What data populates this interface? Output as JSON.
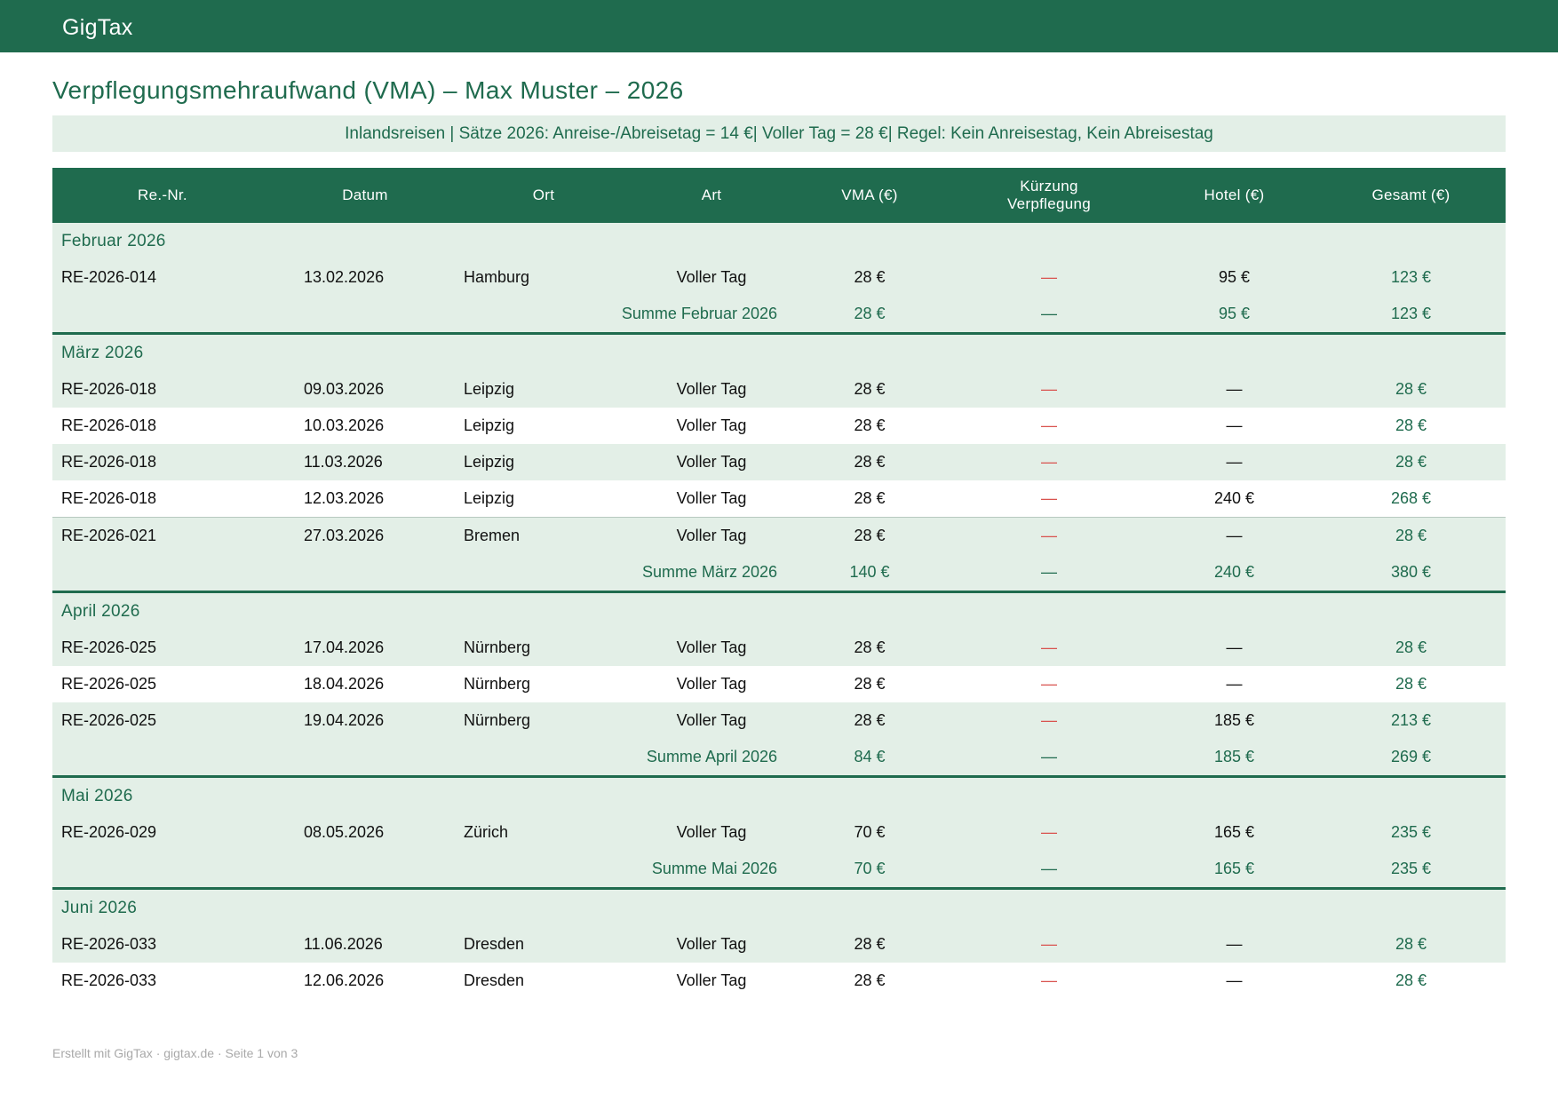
{
  "app": {
    "name": "GigTax"
  },
  "document": {
    "title": "Verpflegungsmehraufwand (VMA) – Max Muster – 2026",
    "info": "Inlandsreisen | Sätze 2026: Anreise-/Abreisetag = 14 €| Voller Tag = 28 €| Regel: Kein Anreisestag, Kein Abreisestag",
    "footer": "Erstellt mit GigTax · gigtax.de · Seite 1 von 3"
  },
  "table": {
    "headers": {
      "re": "Re.-Nr.",
      "datum": "Datum",
      "ort": "Ort",
      "art": "Art",
      "vma": "VMA (€)",
      "kuerzung_1": "Kürzung",
      "kuerzung_2": "Verpflegung",
      "hotel": "Hotel (€)",
      "gesamt": "Gesamt (€)"
    },
    "groups": [
      {
        "month": "Februar 2026",
        "rows": [
          {
            "re": "RE-2026-014",
            "datum": "13.02.2026",
            "ort": "Hamburg",
            "art": "Voller Tag",
            "vma": "28 €",
            "kuerzung": "—",
            "hotel": "95 €",
            "gesamt": "123 €"
          }
        ],
        "sum": {
          "label": "Summe Februar 2026",
          "vma": "28 €",
          "kuerzung": "—",
          "hotel": "95 €",
          "gesamt": "123 €"
        }
      },
      {
        "month": "März 2026",
        "rows": [
          {
            "re": "RE-2026-018",
            "datum": "09.03.2026",
            "ort": "Leipzig",
            "art": "Voller Tag",
            "vma": "28 €",
            "kuerzung": "—",
            "hotel": "—",
            "gesamt": "28 €"
          },
          {
            "re": "RE-2026-018",
            "datum": "10.03.2026",
            "ort": "Leipzig",
            "art": "Voller Tag",
            "vma": "28 €",
            "kuerzung": "—",
            "hotel": "—",
            "gesamt": "28 €"
          },
          {
            "re": "RE-2026-018",
            "datum": "11.03.2026",
            "ort": "Leipzig",
            "art": "Voller Tag",
            "vma": "28 €",
            "kuerzung": "—",
            "hotel": "—",
            "gesamt": "28 €"
          },
          {
            "re": "RE-2026-018",
            "datum": "12.03.2026",
            "ort": "Leipzig",
            "art": "Voller Tag",
            "vma": "28 €",
            "kuerzung": "—",
            "hotel": "240 €",
            "gesamt": "268 €"
          },
          {
            "re": "RE-2026-021",
            "datum": "27.03.2026",
            "ort": "Bremen",
            "art": "Voller Tag",
            "vma": "28 €",
            "kuerzung": "—",
            "hotel": "—",
            "gesamt": "28 €"
          }
        ],
        "sum": {
          "label": "Summe März 2026",
          "vma": "140 €",
          "kuerzung": "—",
          "hotel": "240 €",
          "gesamt": "380 €"
        }
      },
      {
        "month": "April 2026",
        "rows": [
          {
            "re": "RE-2026-025",
            "datum": "17.04.2026",
            "ort": "Nürnberg",
            "art": "Voller Tag",
            "vma": "28 €",
            "kuerzung": "—",
            "hotel": "—",
            "gesamt": "28 €"
          },
          {
            "re": "RE-2026-025",
            "datum": "18.04.2026",
            "ort": "Nürnberg",
            "art": "Voller Tag",
            "vma": "28 €",
            "kuerzung": "—",
            "hotel": "—",
            "gesamt": "28 €"
          },
          {
            "re": "RE-2026-025",
            "datum": "19.04.2026",
            "ort": "Nürnberg",
            "art": "Voller Tag",
            "vma": "28 €",
            "kuerzung": "—",
            "hotel": "185 €",
            "gesamt": "213 €"
          }
        ],
        "sum": {
          "label": "Summe April 2026",
          "vma": "84 €",
          "kuerzung": "—",
          "hotel": "185 €",
          "gesamt": "269 €"
        }
      },
      {
        "month": "Mai 2026",
        "rows": [
          {
            "re": "RE-2026-029",
            "datum": "08.05.2026",
            "ort": "Zürich",
            "art": "Voller Tag",
            "vma": "70 €",
            "kuerzung": "—",
            "hotel": "165 €",
            "gesamt": "235 €"
          }
        ],
        "sum": {
          "label": "Summe Mai 2026",
          "vma": "70 €",
          "kuerzung": "—",
          "hotel": "165 €",
          "gesamt": "235 €"
        }
      },
      {
        "month": "Juni 2026",
        "rows": [
          {
            "re": "RE-2026-033",
            "datum": "11.06.2026",
            "ort": "Dresden",
            "art": "Voller Tag",
            "vma": "28 €",
            "kuerzung": "—",
            "hotel": "—",
            "gesamt": "28 €"
          },
          {
            "re": "RE-2026-033",
            "datum": "12.06.2026",
            "ort": "Dresden",
            "art": "Voller Tag",
            "vma": "28 €",
            "kuerzung": "—",
            "hotel": "—",
            "gesamt": "28 €"
          }
        ],
        "sum": null
      }
    ]
  },
  "colors": {
    "brand": "#1f6b4e",
    "row_alt": "#e3efe7",
    "kuerzung_dash": "#d9534f",
    "footer_text": "#a9a9a9"
  }
}
